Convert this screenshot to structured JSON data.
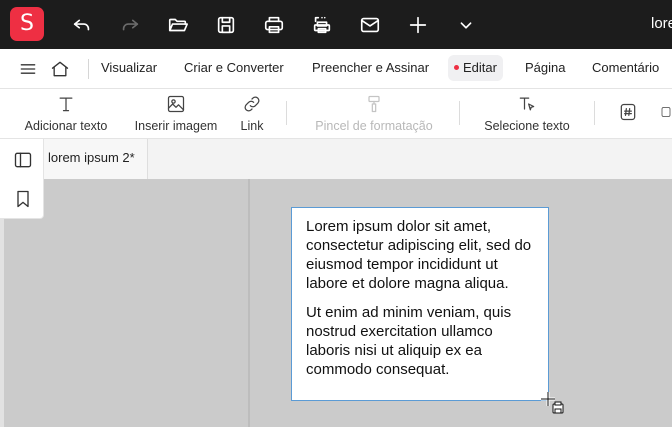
{
  "app": {
    "logo_letter": "S",
    "title_partial": "lore",
    "brand_color": "#ee2f43"
  },
  "titlebar_icons": [
    "undo-icon",
    "redo-icon",
    "open-folder-icon",
    "save-icon",
    "print-icon",
    "scan-icon",
    "mail-icon",
    "plus-icon",
    "chevron-down-icon"
  ],
  "menu": {
    "items": [
      {
        "label": "Visualizar"
      },
      {
        "label": "Criar e Converter"
      },
      {
        "label": "Preencher e Assinar"
      },
      {
        "label": "Editar",
        "active": true
      },
      {
        "label": "Página"
      },
      {
        "label": "Comentário"
      }
    ]
  },
  "ribbon": {
    "items": [
      {
        "label": "Adicionar texto",
        "icon": "text-icon"
      },
      {
        "label": "Inserir imagem",
        "icon": "image-icon"
      },
      {
        "label": "Link",
        "icon": "link-icon"
      },
      {
        "label": "Pincel de formatação",
        "icon": "format-painter-icon",
        "disabled": true
      },
      {
        "label": "Selecione texto",
        "icon": "select-text-icon"
      }
    ]
  },
  "tabs": [
    {
      "label": "lorem ipsum 2*"
    }
  ],
  "document": {
    "paragraphs": [
      "Lorem ipsum dolor sit amet, consectetur adipiscing elit, sed do eiusmod tempor incididunt ut labore et dolore magna aliqua.",
      "Ut enim ad minim veniam, quis nostrud exercitation ullamco laboris nisi ut aliquip ex ea commodo consequat."
    ]
  }
}
